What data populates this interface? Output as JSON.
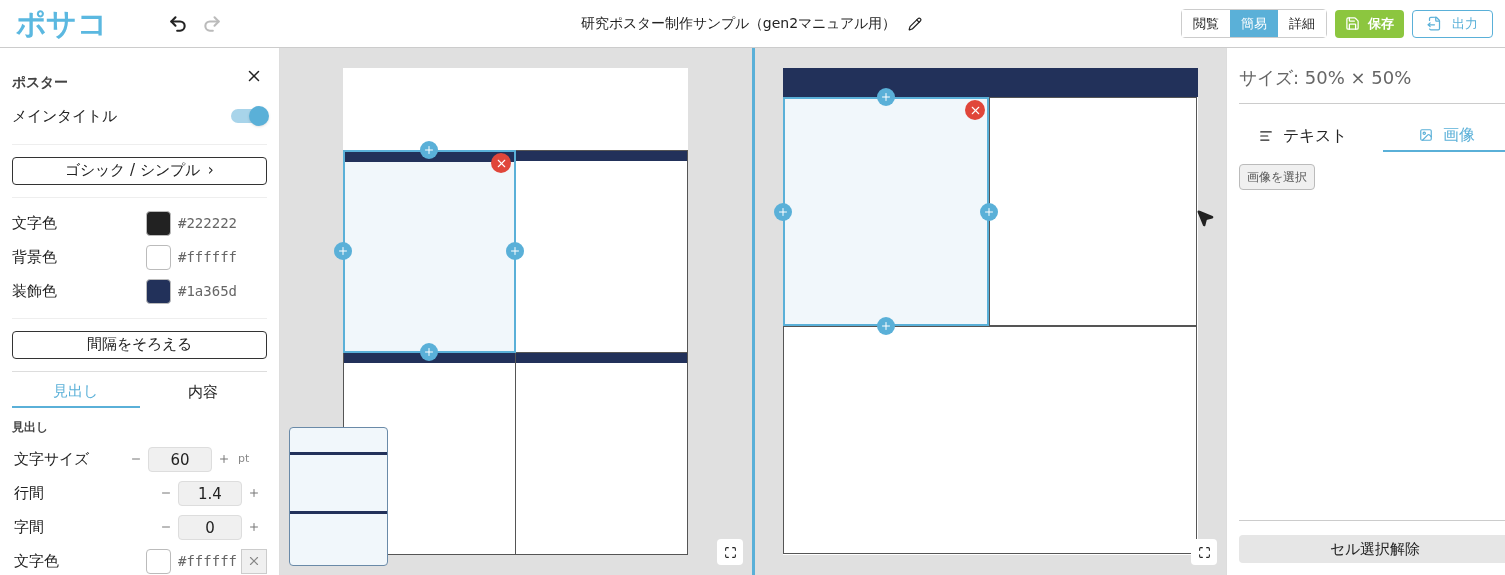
{
  "header": {
    "logo": "ポサコ",
    "title": "研究ポスター制作サンプル（gen2マニュアル用）",
    "view_modes": [
      {
        "label": "閲覧",
        "selected": false
      },
      {
        "label": "簡易",
        "selected": true
      },
      {
        "label": "詳細",
        "selected": false
      }
    ],
    "save_button": "保存",
    "export_button": "出力"
  },
  "sidebar": {
    "section_title": "ポスター",
    "main_title": {
      "label": "メインタイトル",
      "on": true
    },
    "font_button": {
      "label": "ゴシック / シンプル",
      "chevron": "›"
    },
    "colors": [
      {
        "label": "文字色",
        "value": "#222222",
        "color": "#222222"
      },
      {
        "label": "背景色",
        "value": "#ffffff",
        "color": "#ffffff"
      },
      {
        "label": "装飾色",
        "value": "#1a365d",
        "color": "#22315a"
      }
    ],
    "align_button": "間隔をそろえる",
    "tabs": [
      {
        "label": "見出し",
        "selected": true
      },
      {
        "label": "内容",
        "selected": false
      }
    ],
    "subheading": "見出し",
    "fields": [
      {
        "label": "文字サイズ",
        "value": "60",
        "unit": "pt"
      },
      {
        "label": "行間",
        "value": "1.4"
      },
      {
        "label": "字間",
        "value": "0"
      }
    ],
    "text_color": {
      "label": "文字色",
      "value": "#ffffff",
      "color": "#ffffff"
    }
  },
  "left_poster": {
    "cells": [
      {
        "selected": true
      },
      {
        "selected": false
      },
      {
        "selected": false
      },
      {
        "selected": false
      }
    ]
  },
  "right_poster": {
    "cells": [
      {
        "selected": true
      },
      {
        "selected": false
      },
      {
        "selected": false
      }
    ]
  },
  "right_panel": {
    "size": "サイズ: 50% × 50%",
    "tabs": [
      {
        "label": "テキスト",
        "selected": false
      },
      {
        "label": "画像",
        "selected": true
      }
    ],
    "select_image_button": "画像を選択",
    "deselect_button": "セル選択解除"
  }
}
